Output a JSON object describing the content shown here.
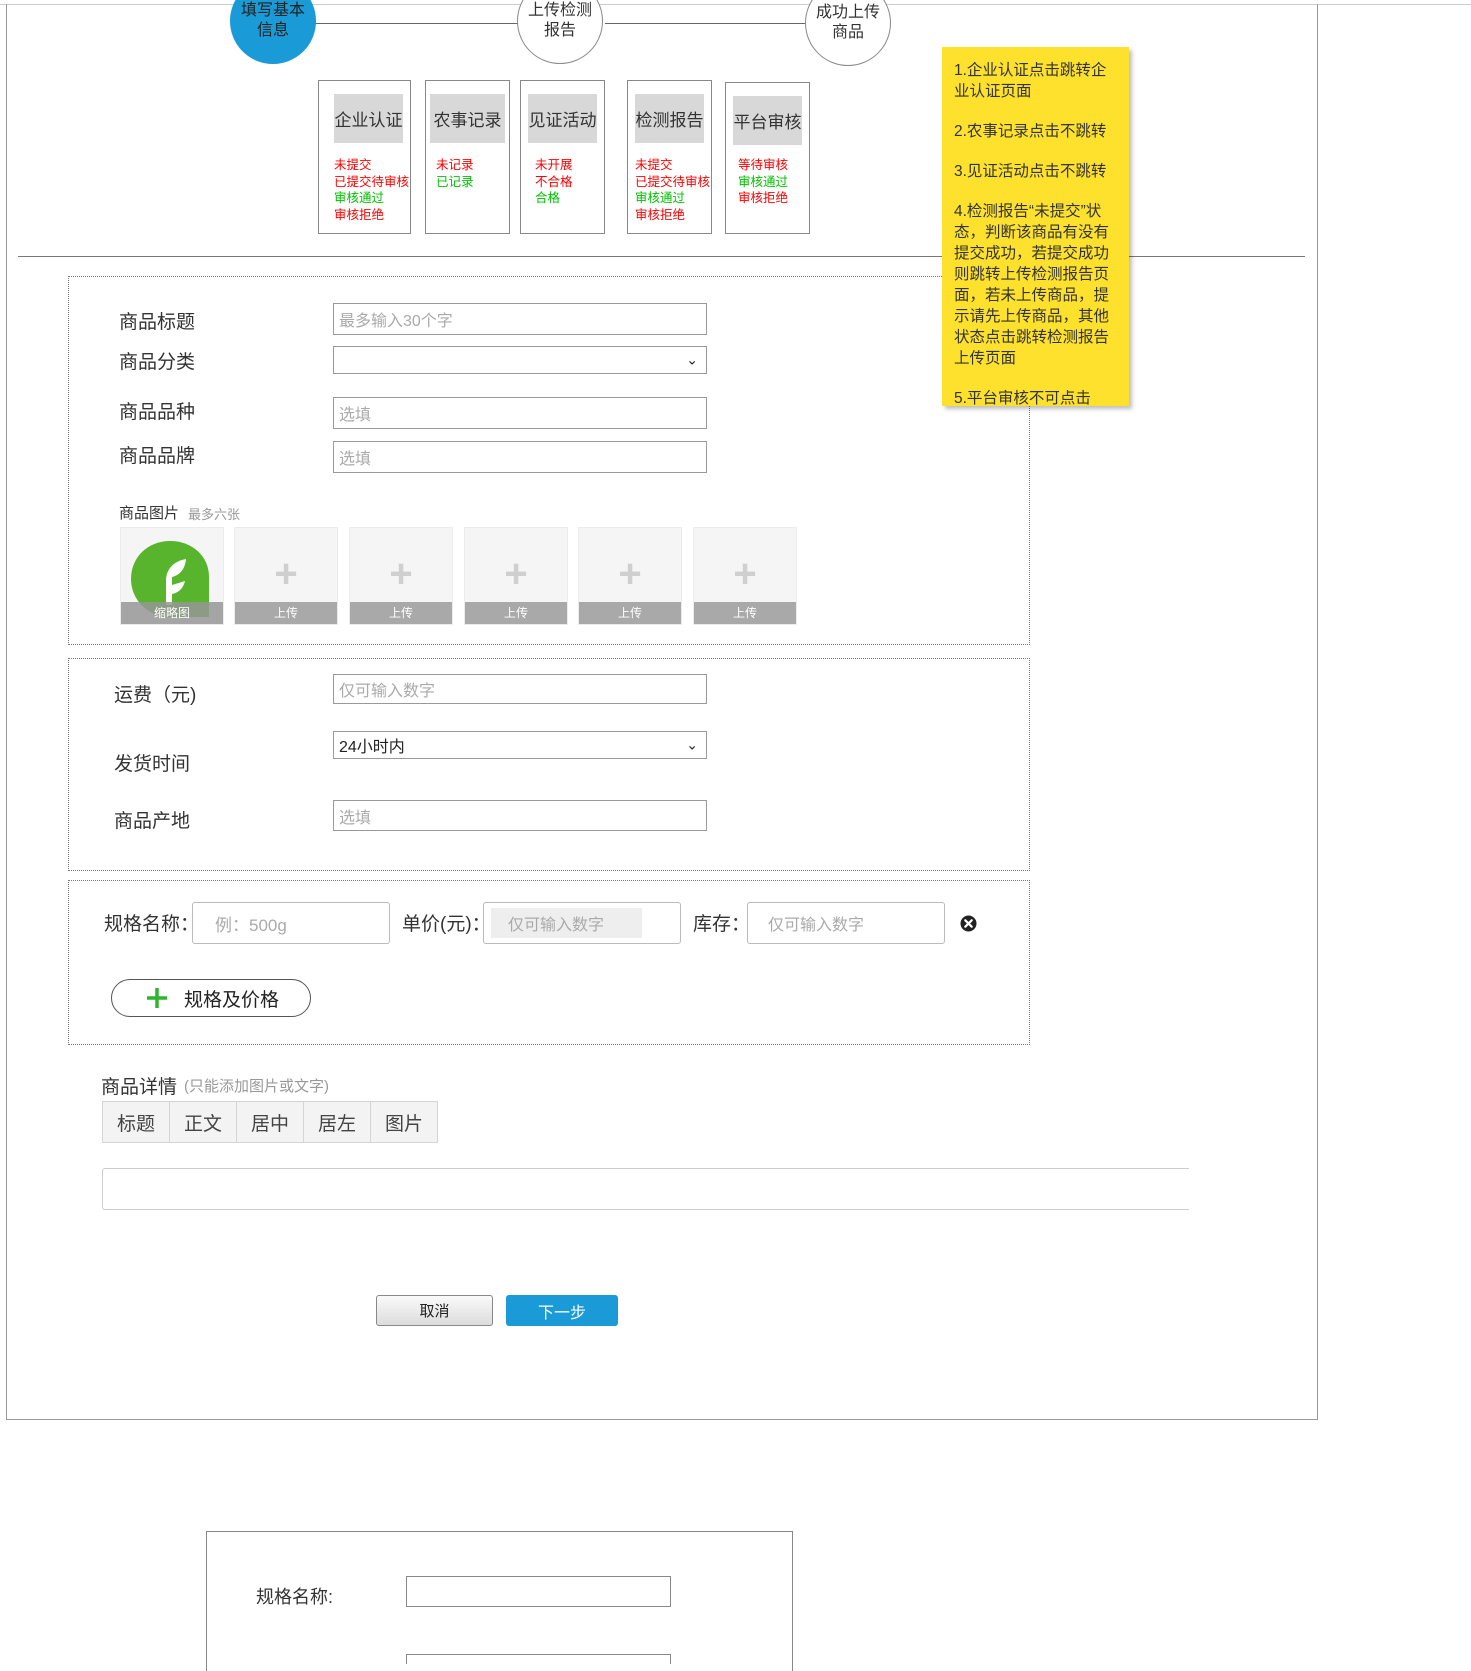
{
  "steps": [
    {
      "label": "填写基本信息"
    },
    {
      "label": "上传检测报告"
    },
    {
      "label": "成功上传商品"
    }
  ],
  "status_boxes": [
    {
      "title": "企业认证",
      "lines": [
        {
          "text": "未提交",
          "color": "#ff0000"
        },
        {
          "text": "已提交待审核",
          "color": "#ff0000"
        },
        {
          "text": "审核通过",
          "color": "#00c000"
        },
        {
          "text": "审核拒绝",
          "color": "#ff0000"
        }
      ]
    },
    {
      "title": "农事记录",
      "lines": [
        {
          "text": "未记录",
          "color": "#ff0000"
        },
        {
          "text": "已记录",
          "color": "#00c000"
        }
      ]
    },
    {
      "title": "见证活动",
      "lines": [
        {
          "text": "未开展",
          "color": "#ff0000"
        },
        {
          "text": "不合格",
          "color": "#ff0000"
        },
        {
          "text": "合格",
          "color": "#00c000"
        }
      ]
    },
    {
      "title": "检测报告",
      "lines": [
        {
          "text": "未提交",
          "color": "#ff0000"
        },
        {
          "text": "已提交待审核",
          "color": "#ff0000"
        },
        {
          "text": "审核通过",
          "color": "#00c000"
        },
        {
          "text": "审核拒绝",
          "color": "#ff0000"
        }
      ]
    },
    {
      "title": "平台审核",
      "lines": [
        {
          "text": "等待审核",
          "color": "#ff0000"
        },
        {
          "text": "审核通过",
          "color": "#00c000"
        },
        {
          "text": "审核拒绝",
          "color": "#ff0000"
        }
      ]
    }
  ],
  "note": {
    "items": [
      "1.企业认证点击跳转企业认证页面",
      "2.农事记录点击不跳转",
      "3.见证活动点击不跳转",
      "4.检测报告“未提交”状态，判断该商品有没有提交成功，若提交成功则跳转上传检测报告页面，若未上传商品，提示请先上传商品，其他状态点击跳转检测报告上传页面",
      "5.平台审核不可点击"
    ]
  },
  "basic": {
    "title_label": "商品标题",
    "title_placeholder": "最多输入30个字",
    "category_label": "商品分类",
    "category_value": "",
    "variety_label": "商品品种",
    "variety_placeholder": "选填",
    "brand_label": "商品品牌",
    "brand_placeholder": "选填",
    "images_label": "商品图片",
    "images_hint": "最多六张",
    "thumb_caption": "缩略图",
    "upload_caption": "上传",
    "upload_count": 5
  },
  "shipping": {
    "fee_label": "运费（元)",
    "fee_placeholder": "仅可输入数字",
    "time_label": "发货时间",
    "time_value": "24小时内",
    "origin_label": "商品产地",
    "origin_placeholder": "选填"
  },
  "spec": {
    "name_label": "规格名称：",
    "name_placeholder": "例：500g",
    "price_label": "单价(元)：",
    "price_placeholder": "仅可输入数字",
    "stock_label": "库存：",
    "stock_placeholder": "仅可输入数字",
    "add_label": "规格及价格"
  },
  "detail": {
    "label": "商品详情",
    "hint": "(只能添加图片或文字)",
    "tools": [
      "标题",
      "正文",
      "居中",
      "居左",
      "图片"
    ]
  },
  "actions": {
    "cancel": "取消",
    "next": "下一步"
  },
  "popup": {
    "spec_name_label": "规格名称:"
  },
  "colors": {
    "accent": "#1a9ad6",
    "note": "#fde12d",
    "status_red": "#ff0000",
    "status_green": "#00c000"
  }
}
